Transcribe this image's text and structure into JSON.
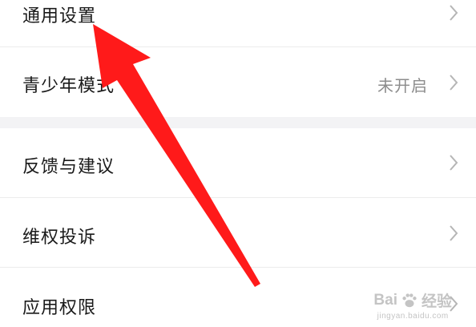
{
  "settings": {
    "items": [
      {
        "label": "通用设置",
        "value": "",
        "chevron": "chevron-right-icon"
      },
      {
        "label": "青少年模式",
        "value": "未开启",
        "chevron": "chevron-right-icon"
      },
      {
        "label": "反馈与建议",
        "value": "",
        "chevron": "chevron-right-icon"
      },
      {
        "label": "维权投诉",
        "value": "",
        "chevron": "chevron-right-icon"
      },
      {
        "label": "应用权限",
        "value": "",
        "chevron": "chevron-right-icon"
      }
    ]
  },
  "annotation": {
    "arrow_color": "#ff1a1a",
    "arrow_icon": "red-pointer-arrow-icon"
  },
  "watermark": {
    "brand_left": "Bai",
    "brand_right": "经验",
    "url": "jingyan.baidu.com"
  },
  "colors": {
    "text": "#1a1a1a",
    "secondary_text": "#8c8c8c",
    "section_gap": "#f3f3f5",
    "divider": "#ececec"
  }
}
